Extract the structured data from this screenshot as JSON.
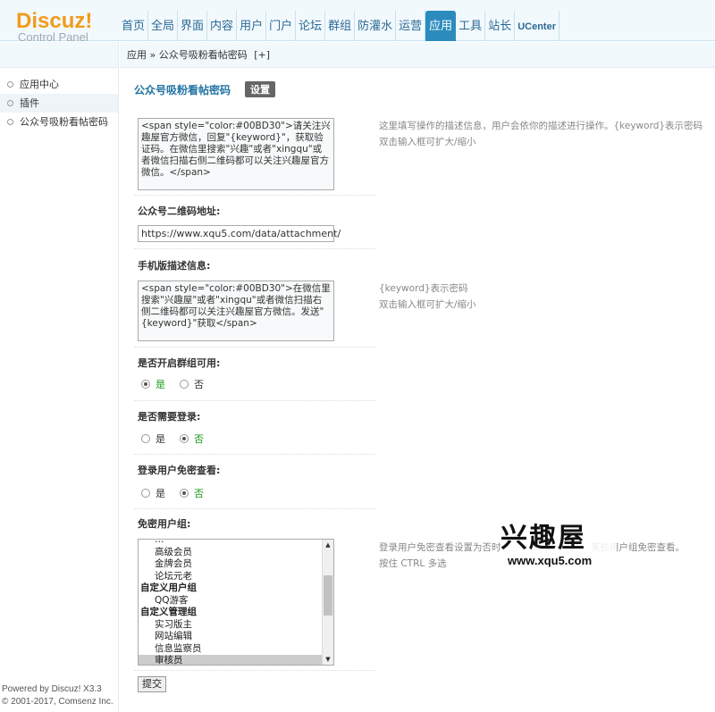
{
  "logo": {
    "brand": "Discuz!",
    "subtitle": "Control Panel"
  },
  "nav": {
    "items": [
      "首页",
      "全局",
      "界面",
      "内容",
      "用户",
      "门户",
      "论坛",
      "群组",
      "防灌水",
      "运营",
      "应用",
      "工具",
      "站长",
      "UCenter"
    ],
    "active": "应用"
  },
  "sidebar": {
    "items": [
      {
        "label": "应用中心"
      },
      {
        "label": "插件"
      },
      {
        "label": "公众号吸粉看帖密码"
      }
    ]
  },
  "breadcrumb": {
    "path": "应用 » 公众号吸粉看帖密码",
    "add": "[+]"
  },
  "page": {
    "title": "公众号吸粉看帖密码",
    "settings_btn": "设置"
  },
  "fields": {
    "desc": {
      "value": "<span style=\"color:#00BD30\">请关注兴趣屋官方微信，回复\"{keyword}\"，获取验证码。在微信里搜索\"兴趣\"或者\"xingqu\"或者微信扫描右侧二维码都可以关注兴趣屋官方微信。</span>",
      "hint1": "这里填写操作的描述信息，用户会依你的描述进行操作。{keyword}表示密码",
      "hint2": "双击输入框可扩大/缩小"
    },
    "qrcode": {
      "label": "公众号二维码地址:",
      "value": "https://www.xqu5.com/data/attachment/"
    },
    "mobile_desc": {
      "label": "手机版描述信息:",
      "value": "<span style=\"color:#00BD30\">在微信里搜索\"兴趣屋\"或者\"xingqu\"或者微信扫描右侧二维码都可以关注兴趣屋官方微信。发送\"{keyword}\"获取</span>",
      "hint1": "{keyword}表示密码",
      "hint2": "双击输入框可扩大/缩小"
    },
    "group_enable": {
      "label": "是否开启群组可用:",
      "yes": "是",
      "no": "否"
    },
    "need_login": {
      "label": "是否需要登录:",
      "yes": "是",
      "no": "否"
    },
    "login_free": {
      "label": "登录用户免密查看:",
      "yes": "是",
      "no": "否"
    },
    "free_groups": {
      "label": "免密用户组:",
      "options": [
        {
          "text": "…",
          "group": false
        },
        {
          "text": "高级会员",
          "group": false
        },
        {
          "text": "金牌会员",
          "group": false
        },
        {
          "text": "论坛元老",
          "group": false
        },
        {
          "text": "自定义用户组",
          "group": true
        },
        {
          "text": "QQ游客",
          "group": false
        },
        {
          "text": "自定义管理组",
          "group": true
        },
        {
          "text": "实习版主",
          "group": false
        },
        {
          "text": "网站编辑",
          "group": false
        },
        {
          "text": "信息监察员",
          "group": false
        },
        {
          "text": "审核员",
          "group": false,
          "selected": true
        }
      ],
      "hint1": "登录用户免密查看设置为否时，",
      "hint1b": "某些用户组免密查看。",
      "hint2": "按住 CTRL 多选"
    }
  },
  "submit_label": "提交",
  "footer": {
    "line1": "Powered by Discuz! X3.3",
    "line2": "© 2001-2017, Comsenz Inc."
  },
  "watermark": {
    "logo": "兴趣屋",
    "url": "www.xqu5.com"
  }
}
